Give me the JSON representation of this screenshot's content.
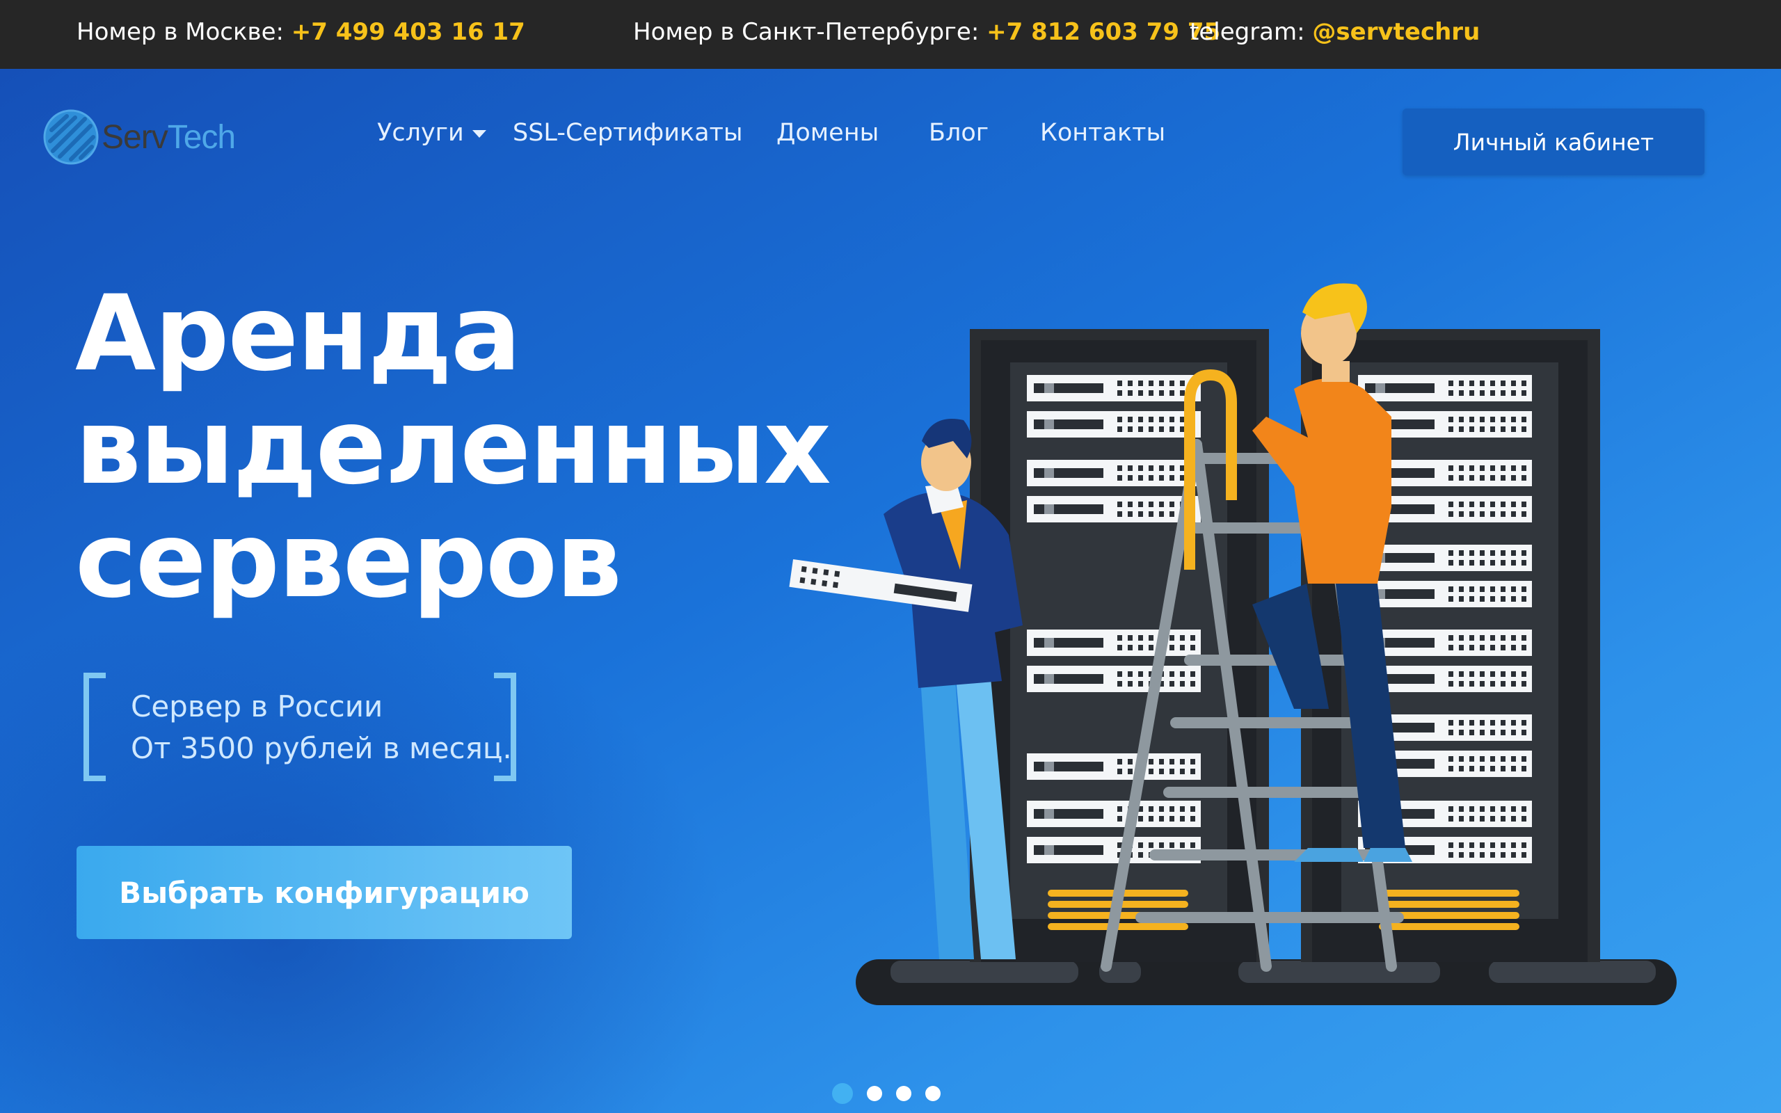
{
  "topbar": {
    "moscow_label": "Номер в Москве:",
    "moscow_phone": "+7 499 403 16 17",
    "spb_label": "Номер в Санкт-Петербурге:",
    "spb_phone": "+7 812 603 79 75",
    "telegram_label": "telegram:",
    "telegram_handle": "@servtechru"
  },
  "logo": {
    "part1": "Serv",
    "part2": "Tech"
  },
  "nav": {
    "items": [
      {
        "label": "Услуги"
      },
      {
        "label": "SSL-Сертификаты"
      },
      {
        "label": "Домены"
      },
      {
        "label": "Блог"
      },
      {
        "label": "Контакты"
      }
    ],
    "cabinet_label": "Личный кабинет"
  },
  "hero": {
    "headline": [
      "Аренда",
      "выделенных",
      "серверов"
    ],
    "tagline": [
      "Сервер в России",
      "От 3500 рублей в месяц."
    ],
    "cta_label": "Выбрать конфигурацию"
  },
  "slider": {
    "count": 4,
    "active": 1
  },
  "colors": {
    "topbar_bg": "#262626",
    "accent_yellow": "#f7c21a",
    "cabinet_button": "#1560c0",
    "cta_button": "#3aa9ee",
    "bracket": "#7fc8f2"
  },
  "icons": [
    "servtech-logo-icon",
    "chevron-down-icon",
    "server-room-illustration"
  ]
}
